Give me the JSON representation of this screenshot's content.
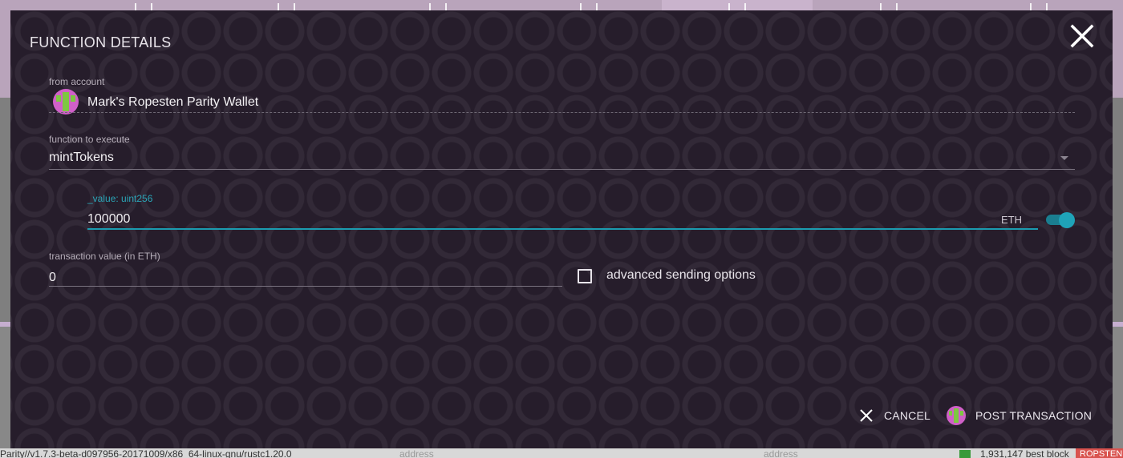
{
  "modal": {
    "title": "FUNCTION DETAILS"
  },
  "from_account": {
    "label": "from account",
    "value": "Mark's Ropesten Parity Wallet",
    "avatar_icon": "identicon-icon"
  },
  "function_to_execute": {
    "label": "function to execute",
    "value": "mintTokens"
  },
  "param": {
    "label": "_value: uint256",
    "value": "100000",
    "unit": "ETH",
    "toggle_on": true
  },
  "transaction_value": {
    "label": "transaction value (in ETH)",
    "value": "0"
  },
  "advanced": {
    "label": "advanced sending options",
    "checked": false
  },
  "buttons": {
    "cancel": "CANCEL",
    "post": "POST TRANSACTION"
  },
  "statusbar": {
    "version": "Parity//v1.7.3-beta-d097956-20171009/x86_64-linux-gnu/rustc1.20.0",
    "address_placeholder_1": "address",
    "address_placeholder_2": "address",
    "block": "1,931,147 best block",
    "network": "ROPSTEN"
  },
  "colors": {
    "accent": "#1fa3b8",
    "modal_bg": "#261d2b",
    "network_badge": "#d9534f"
  }
}
